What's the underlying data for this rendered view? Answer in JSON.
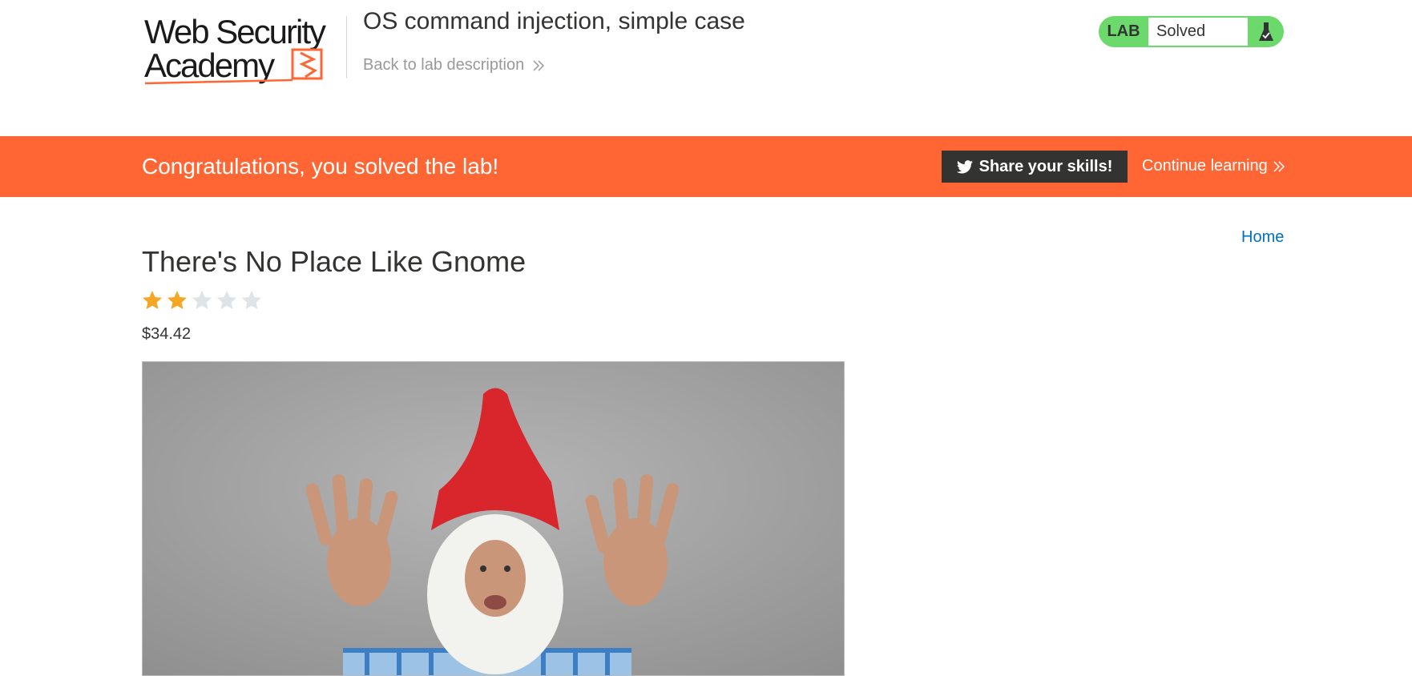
{
  "header": {
    "logo_alt": "Web Security Academy",
    "logo_line1": "Web Security",
    "logo_line2": "Academy",
    "lab_title": "OS command injection, simple case",
    "back_link": "Back to lab description",
    "lab_tag": "LAB",
    "status": "Solved"
  },
  "banner": {
    "message": "Congratulations, you solved the lab!",
    "share_button": "Share your skills!",
    "continue_link": "Continue learning"
  },
  "nav": {
    "home": "Home"
  },
  "product": {
    "title": "There's No Place Like Gnome",
    "rating": 2,
    "rating_max": 5,
    "price": "$34.42"
  },
  "colors": {
    "brand_orange": "#ff6633",
    "lab_green": "#6cd96c",
    "star_filled": "#f5a623",
    "star_empty": "#dde3e6",
    "link_blue": "#0071bc"
  }
}
